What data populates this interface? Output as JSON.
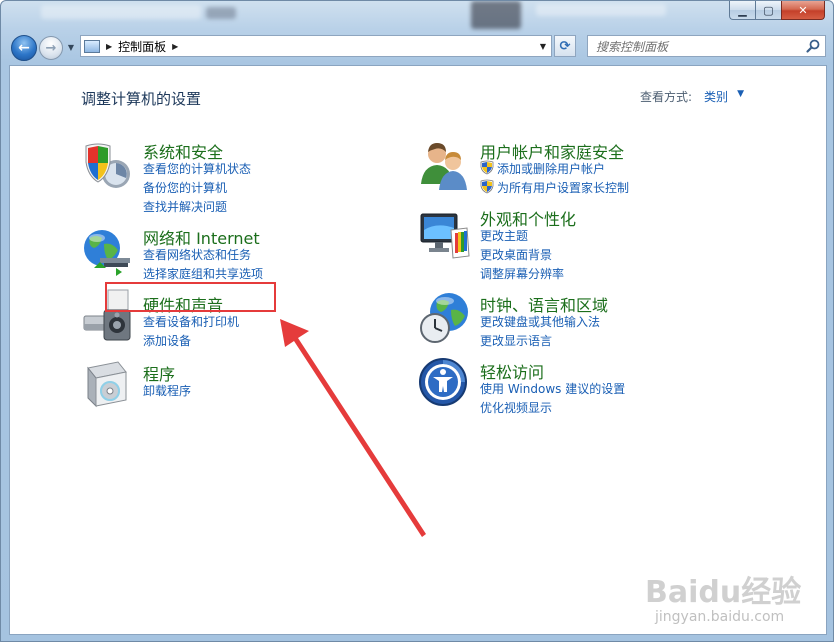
{
  "nav": {
    "breadcrumb": "控制面板",
    "search_placeholder": "搜索控制面板"
  },
  "header": {
    "title": "调整计算机的设置",
    "view_by_label": "查看方式:",
    "view_by_value": "类别"
  },
  "categories": {
    "system": {
      "title": "系统和安全",
      "links": [
        "查看您的计算机状态",
        "备份您的计算机",
        "查找并解决问题"
      ],
      "icon": "shield-icon"
    },
    "network": {
      "title": "网络和 Internet",
      "links": [
        "查看网络状态和任务",
        "选择家庭组和共享选项"
      ],
      "icon": "globe-icon"
    },
    "hardware": {
      "title": "硬件和声音",
      "links": [
        "查看设备和打印机",
        "添加设备"
      ],
      "icon": "printer-icon"
    },
    "programs": {
      "title": "程序",
      "links": [
        "卸载程序"
      ],
      "icon": "program-box-icon"
    },
    "users": {
      "title": "用户帐户和家庭安全",
      "links": [
        "添加或删除用户帐户",
        "为所有用户设置家长控制"
      ],
      "icon": "users-icon"
    },
    "appearance": {
      "title": "外观和个性化",
      "links": [
        "更改主题",
        "更改桌面背景",
        "调整屏幕分辨率"
      ],
      "icon": "monitor-icon"
    },
    "clock": {
      "title": "时钟、语言和区域",
      "links": [
        "更改键盘或其他输入法",
        "更改显示语言"
      ],
      "icon": "clock-globe-icon"
    },
    "ease": {
      "title": "轻松访问",
      "links": [
        "使用 Windows 建议的设置",
        "优化视频显示"
      ],
      "icon": "ease-of-access-icon"
    }
  },
  "watermark": {
    "brand": "Baidu经验",
    "url": "jingyan.baidu.com"
  },
  "colors": {
    "link": "#1a5fb4",
    "category_title": "#1b6e1b",
    "annotation": "#e53b3b"
  }
}
